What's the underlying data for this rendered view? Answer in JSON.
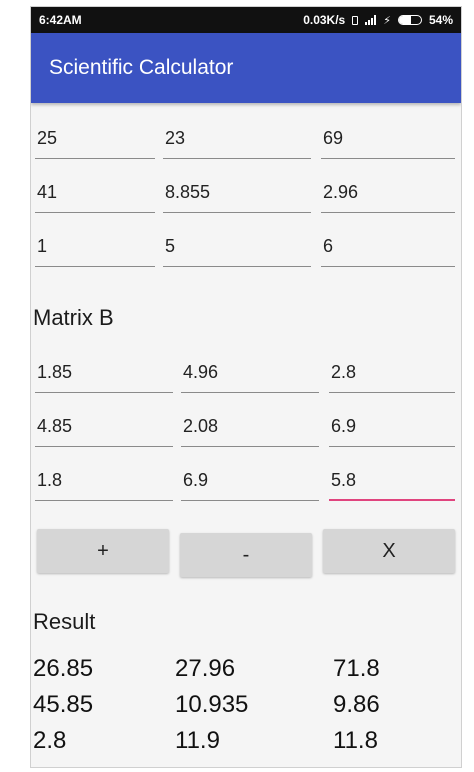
{
  "status_bar": {
    "time": "6:42AM",
    "network_speed": "0.03K/s",
    "battery_percent": "54%",
    "battery_level": 0.54
  },
  "app_bar": {
    "title": "Scientific Calculator"
  },
  "matrix_a": {
    "rows": [
      [
        "25",
        "23",
        "69"
      ],
      [
        "41",
        "8.855",
        "2.96"
      ],
      [
        "1",
        "5",
        "6"
      ]
    ]
  },
  "matrix_b": {
    "label": "Matrix B",
    "rows": [
      [
        "1.85",
        "4.96",
        "2.8"
      ],
      [
        "4.85",
        "2.08",
        "6.9"
      ],
      [
        "1.8",
        "6.9",
        "5.8"
      ]
    ]
  },
  "operations": {
    "add_label": "+",
    "subtract_label": "-",
    "multiply_label": "X"
  },
  "result": {
    "label": "Result",
    "rows": [
      [
        "26.85",
        "27.96",
        "71.8"
      ],
      [
        "45.85",
        "10.935",
        "9.86"
      ],
      [
        "2.8",
        "11.9",
        "11.8"
      ]
    ]
  },
  "colors": {
    "app_bar": "#3b53c2",
    "focus_underline": "#e0447e",
    "button_bg": "#d6d6d6"
  }
}
